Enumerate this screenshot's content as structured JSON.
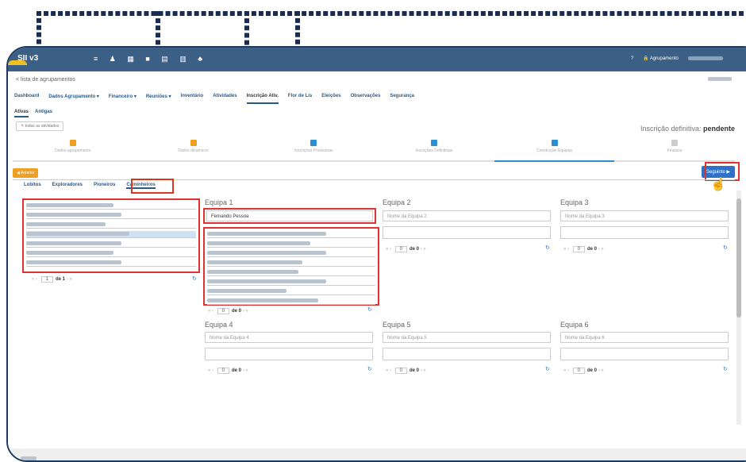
{
  "app": {
    "logo": "SII v3",
    "top_icons": "≡ ♟ ▦ ■ ▤ ▥ ♣",
    "agrupamento_label": "🔒 Agrupamento",
    "help_icon": "?"
  },
  "page": {
    "back_link": "< lista de agrupamentos",
    "nav_tabs": [
      "Dashboard",
      "Dados Agrupamento ▾",
      "Financeiro ▾",
      "Reuniões ▾",
      "Inventário",
      "Atividades",
      "Inscrição Ativ.",
      "Flor de Lis",
      "Eleições",
      "Observações",
      "Segurança"
    ],
    "sub_tabs": [
      "Ativas",
      "Antigas"
    ],
    "todas_button": "↰ todas as atividades",
    "inscricao_label": "Inscrição definitiva: ",
    "inscricao_value": "pendente"
  },
  "steps": [
    {
      "label": "Dados agrupamento",
      "color": "#f0a020"
    },
    {
      "label": "Dados dinamicos",
      "color": "#f0a020"
    },
    {
      "label": "Inscrições Provisórias",
      "color": "#2d8fd0"
    },
    {
      "label": "Inscrições Definitivas",
      "color": "#2d8fd0"
    },
    {
      "label": "Construção Equipas",
      "color": "#2d8fd0"
    },
    {
      "label": "Finalizar",
      "color": "#ccc"
    }
  ],
  "buttons": {
    "anterior": "◀ Anterior",
    "seguinte": "Seguinte ▶"
  },
  "section_tabs": [
    "Lobitos",
    "Exploradores",
    "Pioneiros",
    "Caminheiros"
  ],
  "left_pager": {
    "page": "1",
    "of": "de 1"
  },
  "teams": [
    {
      "title": "Equipa 1",
      "name": "Fernando Pessoa",
      "pager_of": "de 0"
    },
    {
      "title": "Equipa 2",
      "name": "Nome da Equipa 2",
      "pager_of": "de 0"
    },
    {
      "title": "Equipa 3",
      "name": "Nome da Equipa 3",
      "pager_of": "de 0"
    },
    {
      "title": "Equipa 4",
      "name": "Nome da Equipa 4",
      "pager_of": "de 0"
    },
    {
      "title": "Equipa 5",
      "name": "Nome da Equipa 5",
      "pager_of": "de 0"
    },
    {
      "title": "Equipa 6",
      "name": "Nome da Equipa 6",
      "pager_of": "de 0"
    }
  ],
  "pager_zero": "0"
}
